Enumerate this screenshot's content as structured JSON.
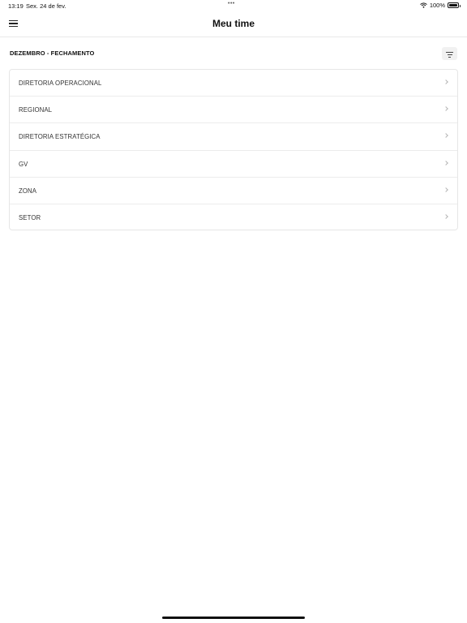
{
  "status_bar": {
    "time": "13:19",
    "date": "Sex. 24 de fev.",
    "dots": "•••",
    "battery": "100%"
  },
  "nav": {
    "title": "Meu time"
  },
  "section": {
    "title": "DEZEMBRO - FECHAMENTO"
  },
  "list": {
    "items": [
      {
        "label": "DIRETORIA OPERACIONAL"
      },
      {
        "label": "REGIONAL"
      },
      {
        "label": "DIRETORIA ESTRATÉGICA"
      },
      {
        "label": "GV"
      },
      {
        "label": "ZONA"
      },
      {
        "label": "SETOR"
      }
    ]
  },
  "icons": {
    "menu": "hamburger-icon",
    "filter": "filter-icon",
    "chevron": "chevron-right-icon",
    "wifi": "wifi-icon",
    "battery": "battery-icon"
  }
}
